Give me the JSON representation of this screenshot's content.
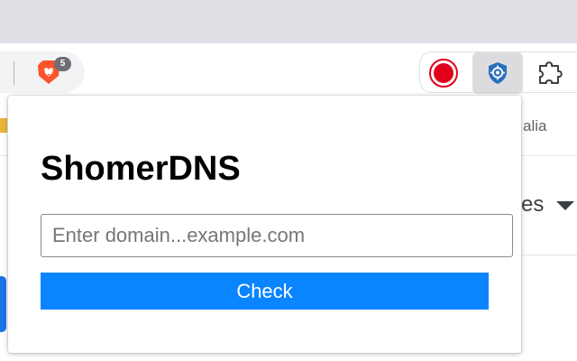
{
  "browser": {
    "brave_badge_count": "5",
    "bookmark_partial_text": "alia",
    "page_partial_text": "es",
    "icons": {
      "brave": "brave-lion-icon",
      "record": "record-icon",
      "shomerdns": "shield-gear-icon",
      "extensions": "puzzle-icon",
      "dropdown": "caret-down-icon"
    }
  },
  "popup": {
    "title": "ShomerDNS",
    "domain_input": {
      "value": "",
      "placeholder": "Enter domain...example.com"
    },
    "check_label": "Check"
  },
  "colors": {
    "tabstrip": "#dfdfe5",
    "check_button": "#0a84ff",
    "record_red": "#e3001b",
    "brave_orange": "#fb542b",
    "shield_blue": "#2a6ebd"
  }
}
